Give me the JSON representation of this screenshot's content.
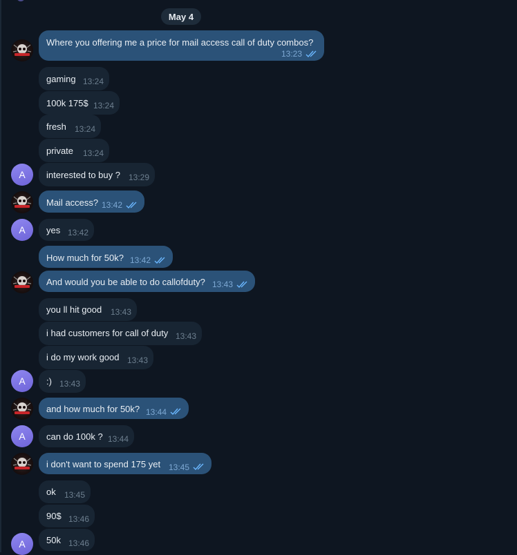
{
  "chat": {
    "date_label": "May 4",
    "avatar_a_letter": "A",
    "messages": [
      {
        "text": "Where you offering me a price for mail access call of duty combos?",
        "time": "13:23",
        "dir": "out"
      },
      {
        "text": "gaming",
        "time": "13:24",
        "dir": "in"
      },
      {
        "text": "100k 175$",
        "time": "13:24",
        "dir": "in"
      },
      {
        "text": "fresh",
        "time": "13:24",
        "dir": "in"
      },
      {
        "text": "private",
        "time": "13:24",
        "dir": "in"
      },
      {
        "text": "interested to buy ?",
        "time": "13:29",
        "dir": "in"
      },
      {
        "text": "Mail access?",
        "time": "13:42",
        "dir": "out"
      },
      {
        "text": "yes",
        "time": "13:42",
        "dir": "in"
      },
      {
        "text": "How much for 50k?",
        "time": "13:42",
        "dir": "out"
      },
      {
        "text": "And would you be able to do callofduty?",
        "time": "13:43",
        "dir": "out"
      },
      {
        "text": "you ll hit good",
        "time": "13:43",
        "dir": "in"
      },
      {
        "text": "i had customers for call of duty",
        "time": "13:43",
        "dir": "in"
      },
      {
        "text": "i do my work good",
        "time": "13:43",
        "dir": "in"
      },
      {
        "text": ":)",
        "time": "13:43",
        "dir": "in"
      },
      {
        "text": "and how much for 50k?",
        "time": "13:44",
        "dir": "out"
      },
      {
        "text": "can do 100k ?",
        "time": "13:44",
        "dir": "in"
      },
      {
        "text": "i don't want to spend 175 yet",
        "time": "13:45",
        "dir": "out"
      },
      {
        "text": "ok",
        "time": "13:45",
        "dir": "in"
      },
      {
        "text": "90$",
        "time": "13:46",
        "dir": "in"
      },
      {
        "text": "50k",
        "time": "13:46",
        "dir": "in"
      }
    ]
  },
  "colors": {
    "background": "#0e1621",
    "incoming_bubble": "#182533",
    "outgoing_bubble": "#2b5278",
    "read_checks": "#6bb7ff",
    "avatar_a": "#7b72e3"
  }
}
